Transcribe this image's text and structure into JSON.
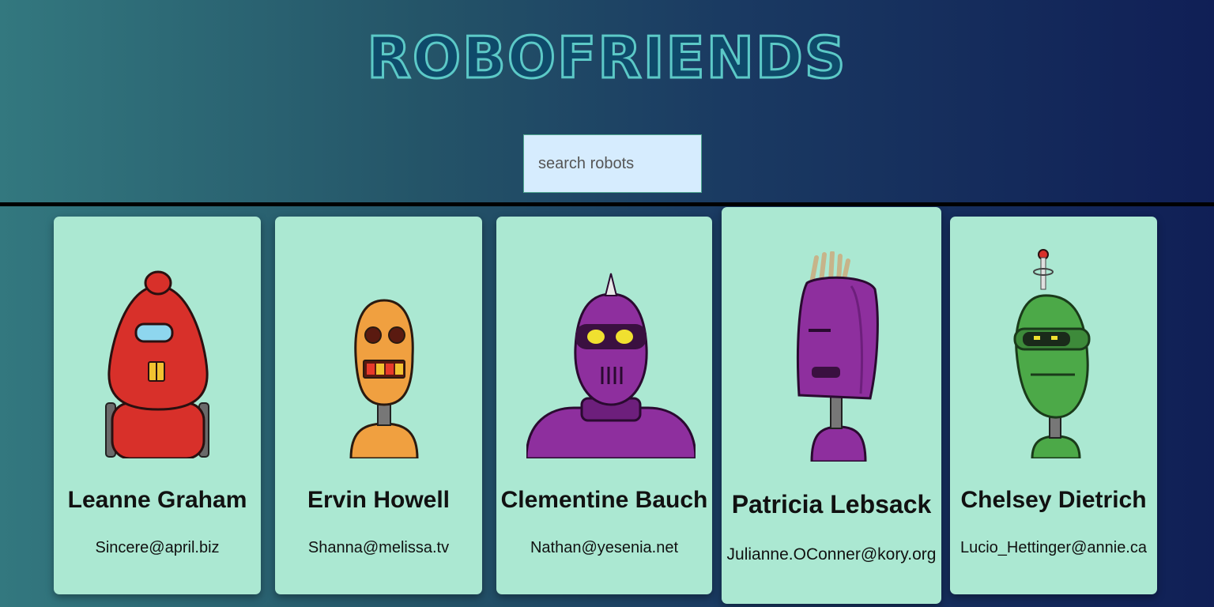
{
  "app": {
    "title": "ROBOFRIENDS"
  },
  "search": {
    "placeholder": "search robots"
  },
  "robots": [
    {
      "name": "Leanne Graham",
      "email": "Sincere@april.biz",
      "color": "#d8302a",
      "avatar": "red-robot-icon"
    },
    {
      "name": "Ervin Howell",
      "email": "Shanna@melissa.tv",
      "color": "#f0a040",
      "avatar": "orange-robot-icon"
    },
    {
      "name": "Clementine Bauch",
      "email": "Nathan@yesenia.net",
      "color": "#8e2f9e",
      "avatar": "purple-robot-icon"
    },
    {
      "name": "Patricia Lebsack",
      "email": "Julianne.OConner@kory.org",
      "color": "#8e2f9e",
      "avatar": "purple-robot-icon"
    },
    {
      "name": "Chelsey Dietrich",
      "email": "Lucio_Hettinger@annie.ca",
      "color": "#4ca948",
      "avatar": "green-robot-icon"
    }
  ]
}
